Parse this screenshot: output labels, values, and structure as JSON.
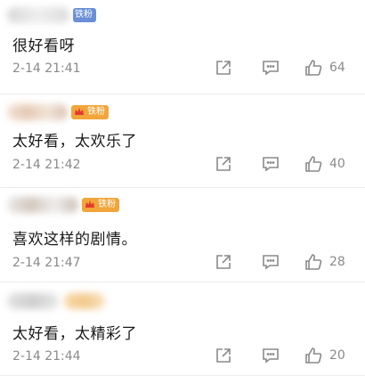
{
  "comments": [
    {
      "text": "很好看呀",
      "time": "2-14 21:41",
      "likes": "64",
      "badge": "铁粉",
      "badge_color": "#6a8fd6"
    },
    {
      "text": "太好看，太欢乐了",
      "time": "2-14 21:42",
      "likes": "40",
      "badge": "铁粉",
      "badge_color": "#f1a53a"
    },
    {
      "text": "喜欢这样的剧情。",
      "time": "2-14 21:47",
      "likes": "28",
      "badge": "铁粉",
      "badge_color": "#f1a53a"
    },
    {
      "text": "太好看，太精彩了",
      "time": "2-14 21:44",
      "likes": "20",
      "badge": "",
      "badge_color": "#f1a53a"
    }
  ],
  "icons": {
    "share": "share-icon",
    "comment": "comment-icon",
    "like": "thumbs-up-icon"
  }
}
